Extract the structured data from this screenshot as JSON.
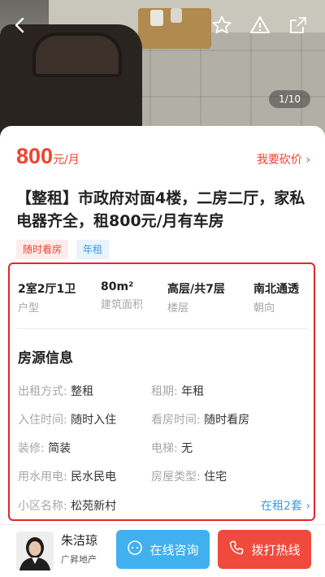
{
  "gallery": {
    "counter": "1/10"
  },
  "header": {
    "back_icon": "back-arrow-icon",
    "favorite_icon": "star-icon",
    "report_icon": "warning-icon",
    "share_icon": "share-icon"
  },
  "listing": {
    "price": "800",
    "price_unit": "元/月",
    "bargain_label": "我要砍价 ›",
    "title": "【整租】市政府对面4楼，二房二厅，家私电器齐全，租800元/月有车房",
    "tags": [
      "随时看房",
      "年租"
    ]
  },
  "stats": [
    {
      "value": "2室2厅1卫",
      "label": "户型"
    },
    {
      "value": "80m²",
      "label": "建筑面积"
    },
    {
      "value": "高层/共7层",
      "label": "楼层"
    },
    {
      "value": "南北通透",
      "label": "朝向"
    }
  ],
  "info_section": {
    "title": "房源信息",
    "rows": [
      {
        "key": "出租方式:",
        "value": "整租"
      },
      {
        "key": "租期:",
        "value": "年租"
      },
      {
        "key": "入住时间:",
        "value": "随时入住"
      },
      {
        "key": "看房时间:",
        "value": "随时看房"
      },
      {
        "key": "装修:",
        "value": "简装"
      },
      {
        "key": "电梯:",
        "value": "无"
      },
      {
        "key": "用水用电:",
        "value": "民水民电"
      },
      {
        "key": "房屋类型:",
        "value": "住宅"
      },
      {
        "key": "小区名称:",
        "value": "松苑新村"
      }
    ],
    "community_link": "在租2套 ›"
  },
  "agent": {
    "name": "朱洁琼",
    "company": "广昇地产",
    "consult_label": "在线咨询",
    "call_label": "拨打热线"
  },
  "colors": {
    "accent_red": "#f0442f",
    "accent_blue": "#41b0ef",
    "highlight_border": "#e0262c"
  }
}
